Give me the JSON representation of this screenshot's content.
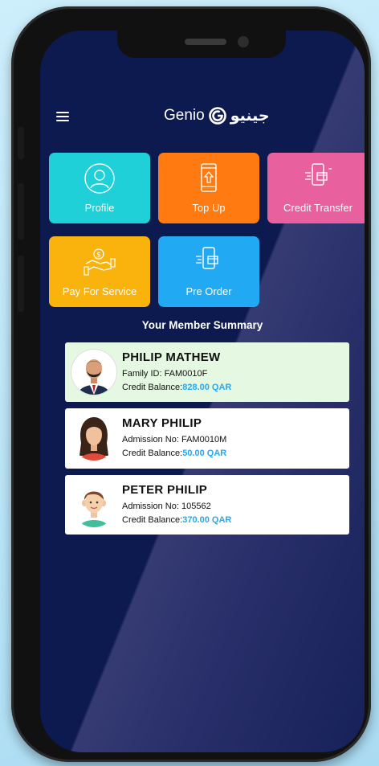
{
  "header": {
    "brand_en": "Genio",
    "brand_ar": "جينيو"
  },
  "tiles": [
    {
      "label": "Profile",
      "color": "#1fd0d9",
      "icon": "profile-icon"
    },
    {
      "label": "Top Up",
      "color": "#ff7a10",
      "icon": "top-up-icon"
    },
    {
      "label": "Credit Transfer",
      "color": "#e8609e",
      "icon": "credit-transfer-icon"
    },
    {
      "label": "Pay For Service",
      "color": "#fab20c",
      "icon": "pay-for-service-icon"
    },
    {
      "label": "Pre Order",
      "color": "#22a9f4",
      "icon": "pre-order-icon"
    }
  ],
  "summary": {
    "title": "Your Member Summary",
    "members": [
      {
        "name": "PHILIP  MATHEW",
        "id_label": "Family ID:",
        "id_value": "FAM0010F",
        "balance_label": "Credit Balance:",
        "balance": "828.00 QAR"
      },
      {
        "name": "MARY  PHILIP",
        "id_label": "Admission No:",
        "id_value": "FAM0010M",
        "balance_label": "Credit Balance:",
        "balance": "50.00 QAR"
      },
      {
        "name": "PETER  PHILIP",
        "id_label": "Admission No:",
        "id_value": "105562",
        "balance_label": "Credit Balance:",
        "balance": "370.00 QAR"
      }
    ]
  },
  "colors": {
    "screen_bg": "#0d1a50",
    "active_card": "#e5f9e2",
    "balance": "#2aa8ea"
  }
}
